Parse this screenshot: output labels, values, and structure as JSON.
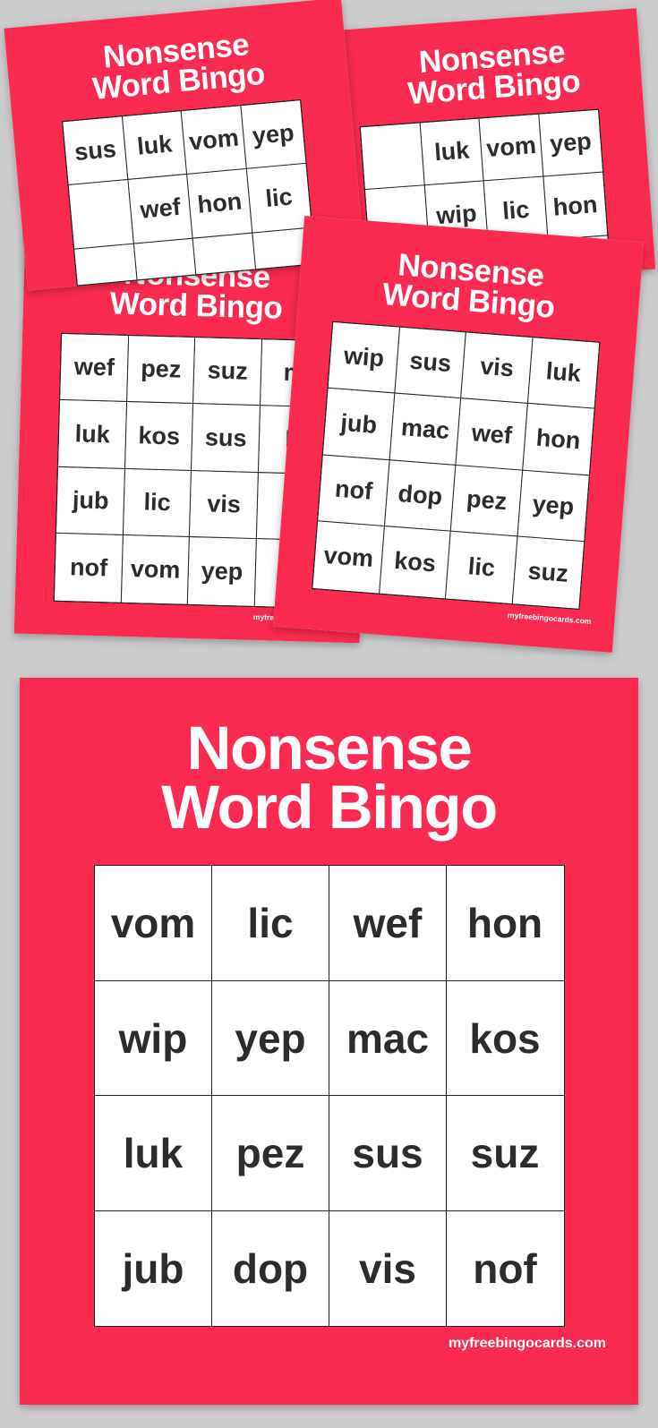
{
  "page": {
    "background_color": "#cccccc",
    "accent_color": "#fb2a50",
    "card_color": "#ffffff",
    "grid_line_color": "#222222",
    "word_color": "#2c2c2c"
  },
  "title": {
    "line1": "Nonsense",
    "line2": "Word Bingo"
  },
  "footer": {
    "label": "myfreebingocards.com"
  },
  "cards": [
    {
      "id": "card-1",
      "position": "top-left",
      "title_line1": "Nonsense",
      "title_line2": "Word Bingo",
      "rows": [
        [
          "sus",
          "luk",
          "vom",
          "yep"
        ],
        [
          "",
          "wef",
          "hon",
          "lic"
        ],
        [
          "",
          "",
          "",
          ""
        ],
        [
          "",
          "",
          "",
          ""
        ]
      ],
      "fully_visible": false
    },
    {
      "id": "card-2",
      "position": "top-right",
      "title_line1": "Nonsense",
      "title_line2": "Word Bingo",
      "rows": [
        [
          "",
          "luk",
          "vom",
          "yep"
        ],
        [
          "",
          "wip",
          "lic",
          "hon"
        ],
        [
          "",
          "",
          "",
          ""
        ],
        [
          "",
          "",
          "",
          ""
        ]
      ],
      "fully_visible": false
    },
    {
      "id": "card-3",
      "position": "middle-left",
      "title_line1": "Nonsense",
      "title_line2": "Word Bingo",
      "rows": [
        [
          "wef",
          "pez",
          "suz",
          "m"
        ],
        [
          "luk",
          "kos",
          "sus",
          "h"
        ],
        [
          "jub",
          "lic",
          "vis",
          ""
        ],
        [
          "nof",
          "vom",
          "yep",
          ""
        ]
      ],
      "footer": "myfreebingocards.com",
      "fully_visible": false
    },
    {
      "id": "card-4",
      "position": "middle-right",
      "title_line1": "Nonsense",
      "title_line2": "Word Bingo",
      "rows": [
        [
          "wip",
          "sus",
          "vis",
          "luk"
        ],
        [
          "jub",
          "mac",
          "wef",
          "hon"
        ],
        [
          "nof",
          "dop",
          "pez",
          "yep"
        ],
        [
          "vom",
          "kos",
          "lic",
          "suz"
        ]
      ],
      "footer": "myfreebingocards.com",
      "fully_visible": true
    },
    {
      "id": "card-main",
      "position": "bottom-large",
      "title_line1": "Nonsense",
      "title_line2": "Word Bingo",
      "rows": [
        [
          "vom",
          "lic",
          "wef",
          "hon"
        ],
        [
          "wip",
          "yep",
          "mac",
          "kos"
        ],
        [
          "luk",
          "pez",
          "sus",
          "suz"
        ],
        [
          "jub",
          "dop",
          "vis",
          "nof"
        ]
      ],
      "footer": "myfreebingocards.com",
      "fully_visible": true
    }
  ]
}
